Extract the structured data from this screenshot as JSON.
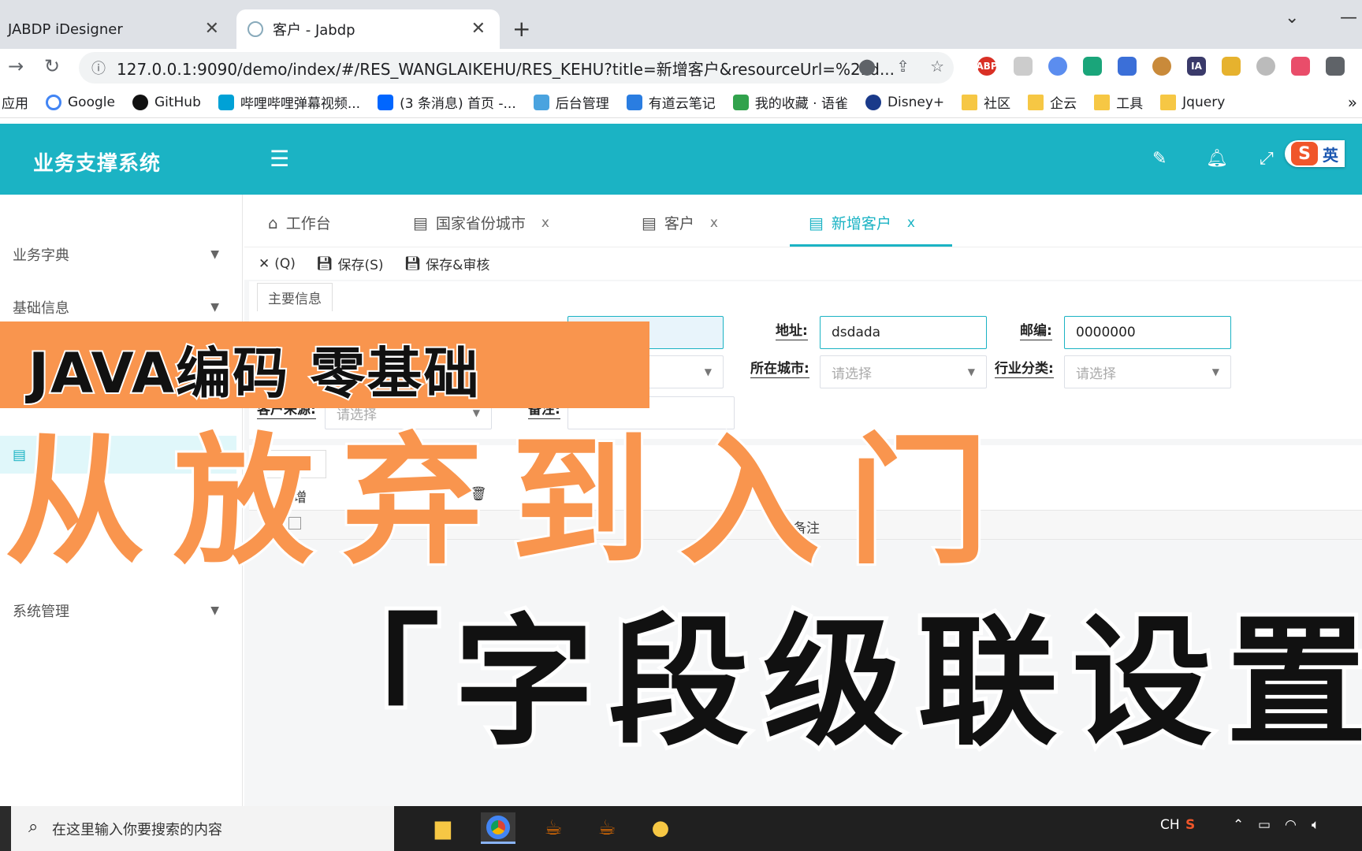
{
  "browser": {
    "tabs": [
      {
        "label": "JABDP iDesigner",
        "active": false
      },
      {
        "label": "客户 - Jabdp",
        "active": true
      }
    ],
    "new_tab": "+",
    "url": "127.0.0.1:9090/demo/index/#/RES_WANGLAIKEHU/RES_KEHU?title=新增客户&resourceUrl=%2Fd...",
    "bookmarks": [
      "应用",
      "Google",
      "GitHub",
      "哔哩哔哩弹幕视频...",
      "(3 条消息) 首页 -...",
      "后台管理",
      "有道云笔记",
      "我的收藏 · 语雀",
      "Disney+",
      "社区",
      "企云",
      "工具",
      "Jquery"
    ],
    "extensions": [
      "ABP",
      "IA"
    ]
  },
  "app": {
    "title": "业务支撑系统",
    "ime_label": "英",
    "sidebar": {
      "items": [
        {
          "label": "业务字典"
        },
        {
          "label": "基础信息"
        },
        {
          "label": "系统管理"
        }
      ]
    },
    "page_tabs": [
      {
        "label": "工作台",
        "closable": false
      },
      {
        "label": "国家省份城市",
        "closable": true
      },
      {
        "label": "客户",
        "closable": true
      },
      {
        "label": "新增客户",
        "closable": true,
        "active": true
      }
    ],
    "close_mark": "x",
    "toolbar": {
      "close_label": "(Q)",
      "save_label": "保存(S)",
      "save_audit_label": "保存&审核"
    },
    "form": {
      "tab_label": "主要信息",
      "address_label": "地址:",
      "address_value": "dsdada",
      "zip_label": "邮编:",
      "zip_value": "0000000",
      "city_label": "所在城市:",
      "city_placeholder": "请选择",
      "industry_label": "行业分类:",
      "industry_placeholder": "请选择",
      "source_label": "客户来源:",
      "source_placeholder": "请选择",
      "remark_label": "备注:"
    },
    "grid": {
      "add_label": "增",
      "remark_col": "备注"
    }
  },
  "overlay": {
    "top_text": "JAVA编码 零基础",
    "middle_text": "从放弃到入门",
    "bottom_text": "「字段级联设置"
  },
  "taskbar": {
    "search_placeholder": "在这里输入你要搜索的内容",
    "lang": "CH"
  },
  "colors": {
    "brand_teal": "#1bb3c4",
    "banner_orange": "#f9954e"
  }
}
